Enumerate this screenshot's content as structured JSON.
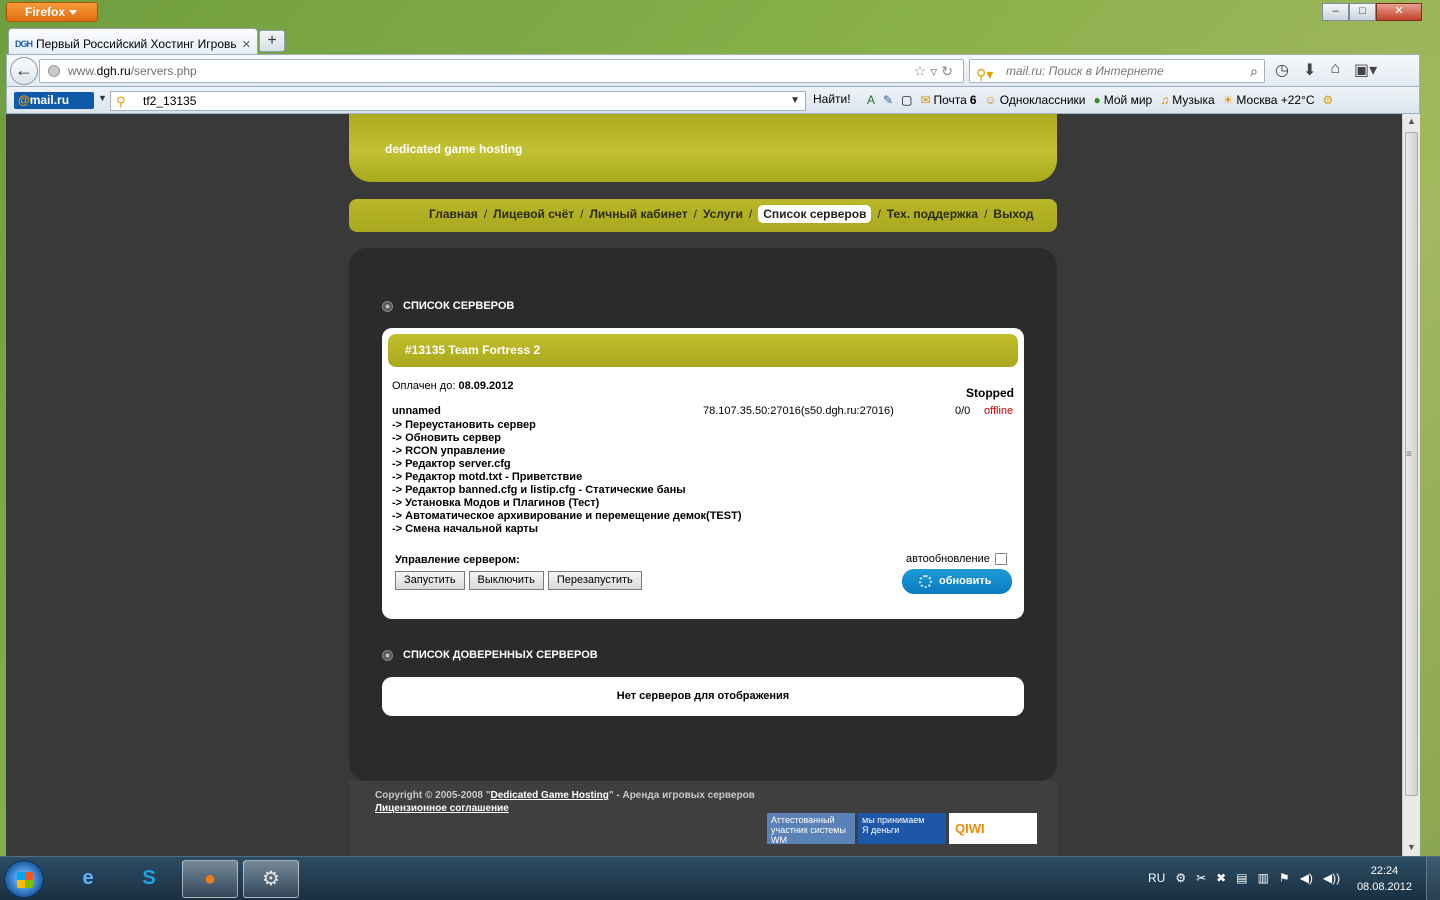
{
  "browser": {
    "app_button": "Firefox",
    "tab_title": "Первый Российский Хостинг Игровых ...",
    "tab_favicon": "DGH",
    "url_prefix": "www.",
    "url_domain": "dgh.ru",
    "url_path": "/servers.php",
    "search_placeholder": "mail.ru: Поиск в Интернете"
  },
  "mailru_bar": {
    "logo": "mail.ru",
    "logo_at": "@",
    "search_value": "tf2_13135",
    "find_label": "Найти!",
    "mail_label": "Почта",
    "mail_count": "6",
    "ok_label": "Одноклассники",
    "mymir_label": "Мой мир",
    "music_label": "Музыка",
    "weather_label": "Москва +22°C"
  },
  "site": {
    "tagline": "dedicated game hosting",
    "menu": [
      "Главная",
      "Лицевой счёт",
      "Личный кабинет",
      "Услуги",
      "Список серверов",
      "Тех. поддержка",
      "Выход"
    ],
    "menu_active_index": 4,
    "servers_title": "СПИСОК СЕРВЕРОВ",
    "server": {
      "header": "#13135 Team Fortress 2",
      "paid_label": "Оплачен до:",
      "paid_date": "08.09.2012",
      "status": "Stopped",
      "name": "unnamed",
      "address": "78.107.35.50:27016(s50.dgh.ru:27016)",
      "players": "0/0",
      "state": "offline",
      "actions": [
        "-> Переустановить сервер",
        "-> Обновить сервер",
        "-> RCON управление",
        "-> Редактор server.cfg",
        "-> Редактор motd.txt - Приветствие",
        "-> Редактор banned.cfg и listip.cfg - Статические баны",
        "-> Установка Модов и Плагинов (Тест)",
        "-> Автоматическое архивирование и перемещение демок(TEST)",
        "-> Смена начальной карты"
      ],
      "mgmt_label": "Управление сервером:",
      "btn_start": "Запустить",
      "btn_stop": "Выключить",
      "btn_restart": "Перезапустить",
      "auto_label": "автообновление",
      "refresh_label": "обновить"
    },
    "trusted_title": "СПИСОК ДОВЕРЕННЫХ СЕРВЕРОВ",
    "trusted_empty": "Нет серверов для отображения",
    "footer": {
      "copyright_pre": "Copyright © 2005-2008 \"",
      "copyright_link": "Dedicated Game Hosting",
      "copyright_post": "\" - Аренда игровых серверов",
      "license": "Лицензионное соглашение",
      "badge_wm_top": "Аттестованный",
      "badge_wm_bottom": "участник системы WM",
      "badge_ym_top": "мы принимаем",
      "badge_ym_bottom": "Я деньги",
      "badge_qiwi": "QIWI"
    }
  },
  "taskbar": {
    "lang": "RU",
    "time": "22:24",
    "date": "08.08.2012"
  }
}
